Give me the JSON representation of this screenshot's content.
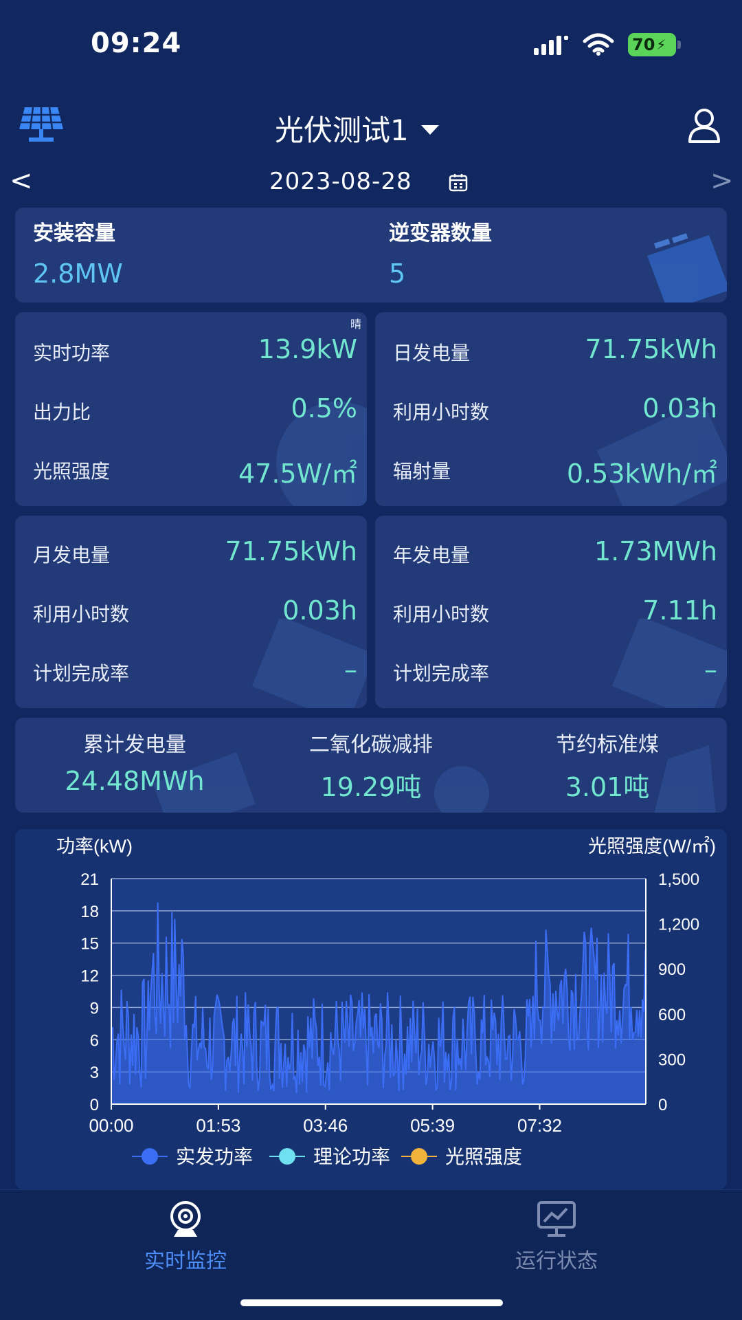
{
  "status_bar": {
    "time": "09:24",
    "battery": "70"
  },
  "header": {
    "station_name": "光伏测试1",
    "date": "2023-08-28",
    "prev": "<",
    "next": ">"
  },
  "capacity": {
    "install_label": "安装容量",
    "install_value": "2.8MW",
    "inverter_label": "逆变器数量",
    "inverter_value": "5"
  },
  "realtime": {
    "weather": "晴",
    "items": [
      {
        "label": "实时功率",
        "value": "13.9kW"
      },
      {
        "label": "出力比",
        "value": "0.5%"
      },
      {
        "label": "光照强度",
        "value": "47.5W/㎡"
      }
    ]
  },
  "daily": {
    "items": [
      {
        "label": "日发电量",
        "value": "71.75kWh"
      },
      {
        "label": "利用小时数",
        "value": "0.03h"
      },
      {
        "label": "辐射量",
        "value": "0.53kWh/㎡"
      }
    ]
  },
  "monthly": {
    "items": [
      {
        "label": "月发电量",
        "value": "71.75kWh"
      },
      {
        "label": "利用小时数",
        "value": "0.03h"
      },
      {
        "label": "计划完成率",
        "value": "–"
      }
    ]
  },
  "yearly": {
    "items": [
      {
        "label": "年发电量",
        "value": "1.73MWh"
      },
      {
        "label": "利用小时数",
        "value": "7.11h"
      },
      {
        "label": "计划完成率",
        "value": "–"
      }
    ]
  },
  "totals": [
    {
      "label": "累计发电量",
      "value": "24.48MWh"
    },
    {
      "label": "二氧化碳减排",
      "value": "19.29吨"
    },
    {
      "label": "节约标准煤",
      "value": "3.01吨"
    }
  ],
  "chart_data": {
    "type": "area",
    "ylabel": "功率(kW)",
    "y2label": "光照强度(W/㎡)",
    "ylim": [
      0,
      21
    ],
    "y_ticks": [
      "0",
      "3",
      "6",
      "9",
      "12",
      "15",
      "18",
      "21"
    ],
    "y2lim": [
      0,
      1500
    ],
    "y2_ticks": [
      "0",
      "300",
      "600",
      "900",
      "1,200",
      "1,500"
    ],
    "x_ticks": [
      "00:00",
      "01:53",
      "03:46",
      "05:39",
      "07:32"
    ],
    "x_range_minutes": [
      0,
      564
    ],
    "grid": true,
    "legend_position": "bottom",
    "series": [
      {
        "name": "实发功率",
        "color": "#3b6ef5",
        "segments": [
          {
            "from": 0,
            "to": 40,
            "low": 1,
            "high": 12
          },
          {
            "from": 40,
            "to": 80,
            "low": 4,
            "high": 19
          },
          {
            "from": 80,
            "to": 445,
            "low": 1,
            "high": 10.5
          },
          {
            "from": 445,
            "to": 564,
            "low": 5,
            "high": 16.5
          }
        ]
      },
      {
        "name": "理论功率",
        "color": "#6ee0f0"
      },
      {
        "name": "光照强度",
        "color": "#f2b33d"
      }
    ]
  },
  "nav": [
    {
      "label": "实时监控",
      "icon": "camera-icon",
      "active": true
    },
    {
      "label": "运行状态",
      "icon": "monitor-chart-icon",
      "active": false
    }
  ],
  "colors": {
    "accent": "#72e6cf",
    "capacity": "#5fc6f4",
    "nav_active": "#4d8df5",
    "nav_inactive": "#7d8cb0"
  }
}
